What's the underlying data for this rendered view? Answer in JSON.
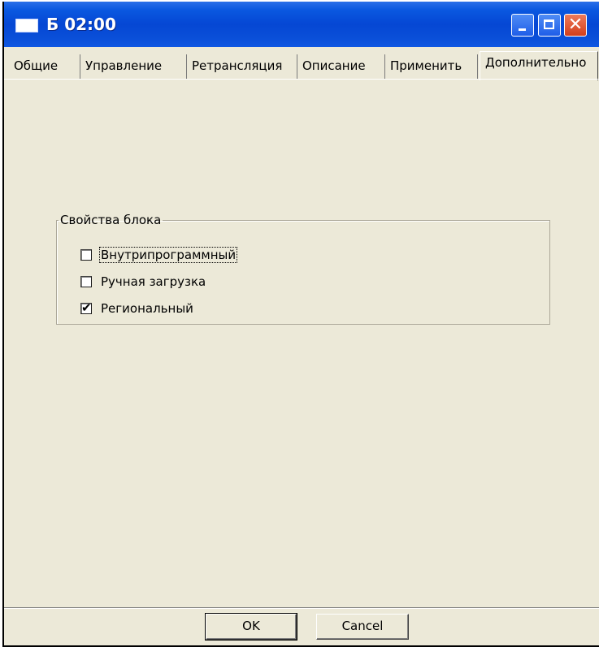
{
  "window": {
    "title": "Б 02:00"
  },
  "tabs": [
    {
      "label": "Общие",
      "active": false
    },
    {
      "label": "Управление",
      "active": false
    },
    {
      "label": "Ретрансляция",
      "active": false
    },
    {
      "label": "Описание",
      "active": false
    },
    {
      "label": "Применить",
      "active": false
    },
    {
      "label": "Дополнительно",
      "active": true
    }
  ],
  "group": {
    "title": "Свойства блока",
    "checkboxes": [
      {
        "label": "Внутрипрограммный",
        "checked": false,
        "focused": true
      },
      {
        "label": "Ручная загрузка",
        "checked": false,
        "focused": false
      },
      {
        "label": "Региональный",
        "checked": true,
        "focused": false
      }
    ]
  },
  "buttons": {
    "ok": "OK",
    "cancel": "Cancel"
  },
  "icons": {
    "app": "window-icon",
    "minimize": "minimize-icon",
    "maximize": "maximize-icon",
    "close": "close-icon",
    "close_glyph": "✕",
    "check_glyph": "✔"
  }
}
